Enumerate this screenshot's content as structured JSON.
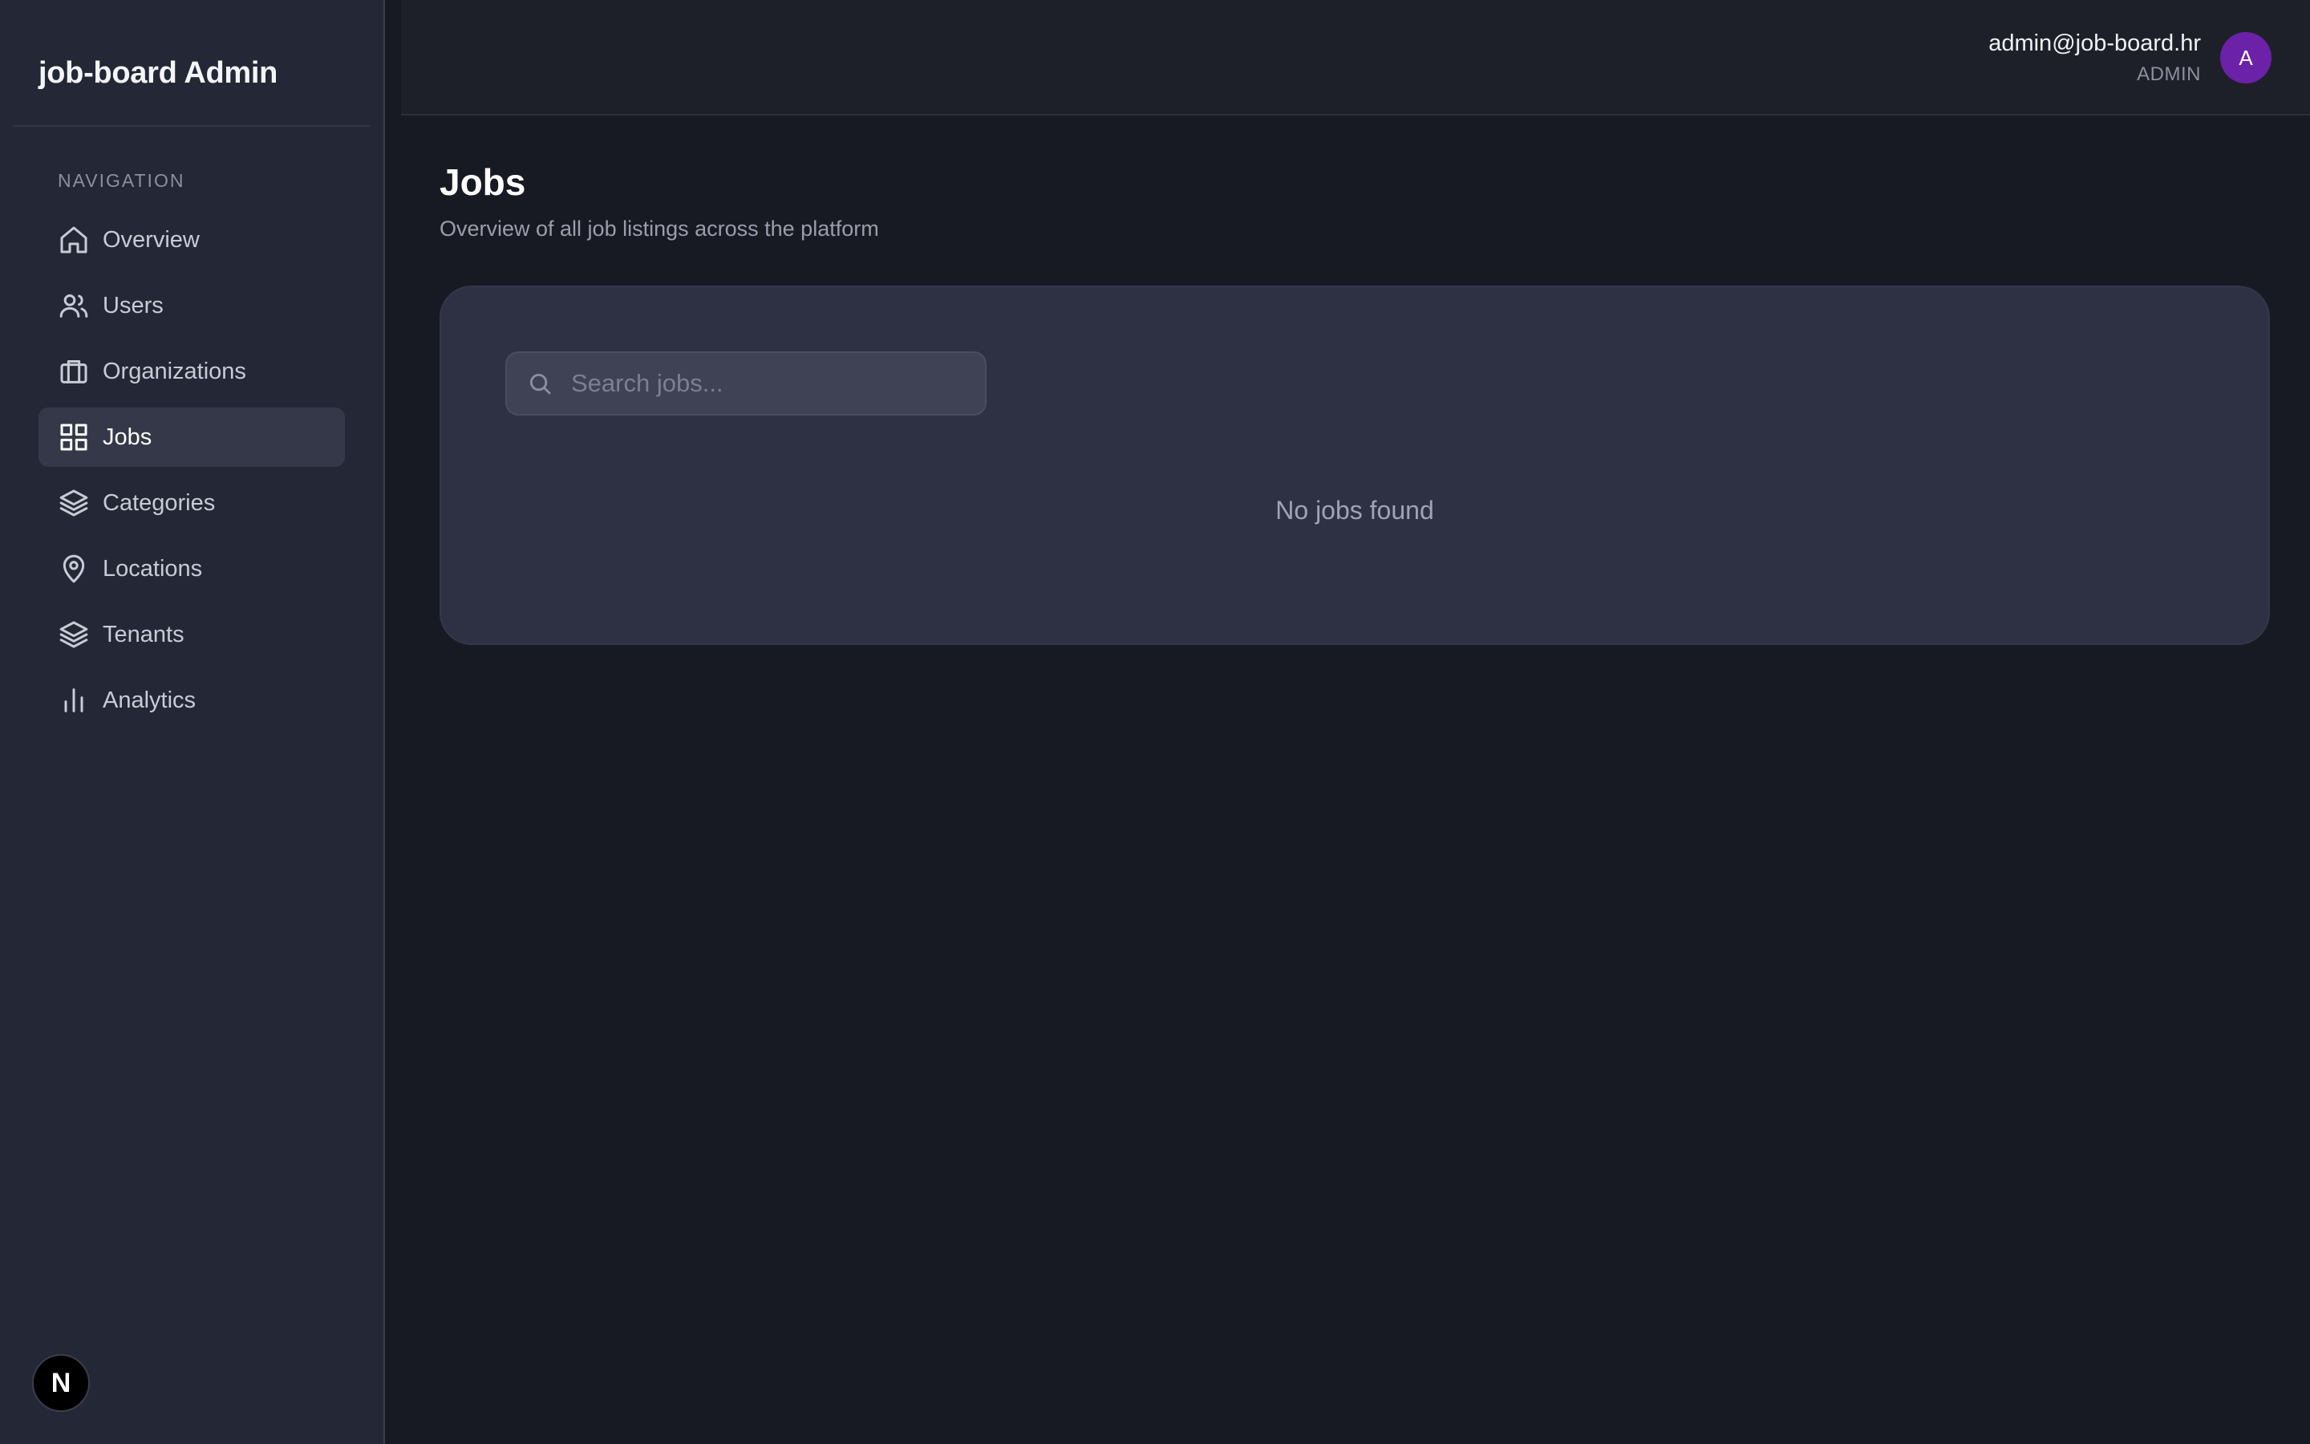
{
  "sidebar": {
    "brand": "job-board Admin",
    "nav_heading": "NAVIGATION",
    "items": [
      {
        "label": "Overview",
        "icon": "home-icon",
        "active": false
      },
      {
        "label": "Users",
        "icon": "users-icon",
        "active": false
      },
      {
        "label": "Organizations",
        "icon": "briefcase-icon",
        "active": false
      },
      {
        "label": "Jobs",
        "icon": "grid-icon",
        "active": true
      },
      {
        "label": "Categories",
        "icon": "layers-icon",
        "active": false
      },
      {
        "label": "Locations",
        "icon": "map-pin-icon",
        "active": false
      },
      {
        "label": "Tenants",
        "icon": "layers-icon",
        "active": false
      },
      {
        "label": "Analytics",
        "icon": "bar-chart-icon",
        "active": false
      }
    ],
    "dev_badge": "N"
  },
  "header": {
    "user_email": "admin@job-board.hr",
    "user_role": "ADMIN",
    "avatar_initial": "A",
    "avatar_color": "#6b21a8"
  },
  "main": {
    "title": "Jobs",
    "subtitle": "Overview of all job listings across the platform",
    "search": {
      "placeholder": "Search jobs...",
      "value": ""
    },
    "empty_message": "No jobs found"
  },
  "colors": {
    "background": "#181a23",
    "sidebar": "#242736",
    "card": "#2e3143",
    "active_item": "#353848"
  }
}
